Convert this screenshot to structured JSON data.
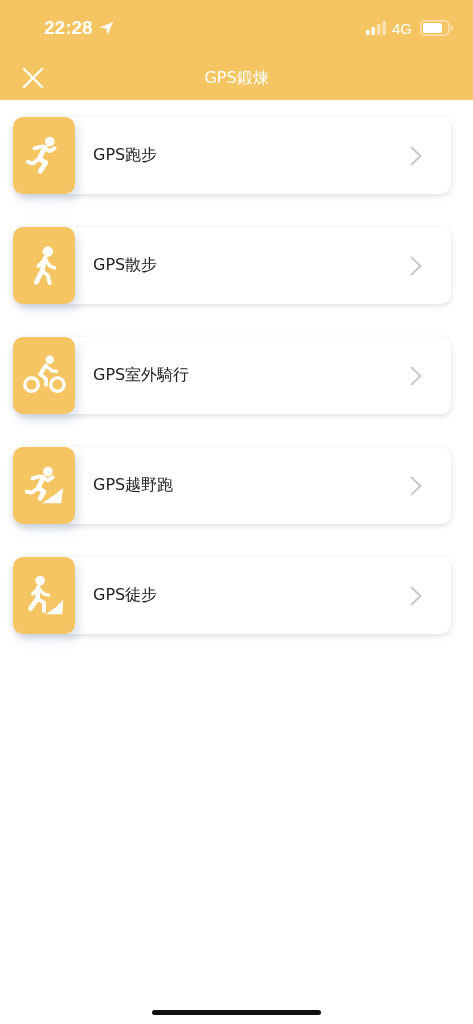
{
  "status_bar": {
    "time": "22:28",
    "network": "4G"
  },
  "nav": {
    "title": "GPS鍛煉"
  },
  "items": [
    {
      "label": "GPS跑步",
      "kind": "run"
    },
    {
      "label": "GPS散步",
      "kind": "walk"
    },
    {
      "label": "GPS室外騎行",
      "kind": "bike"
    },
    {
      "label": "GPS越野跑",
      "kind": "trail"
    },
    {
      "label": "GPS徒步",
      "kind": "hike"
    }
  ]
}
